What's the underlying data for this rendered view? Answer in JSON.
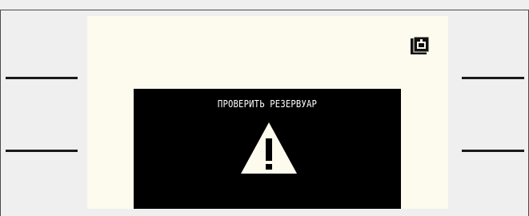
{
  "display": {
    "alert_message": "ПРОВЕРИТЬ РЕЗЕРВУАР",
    "status_icon": "tank-icon",
    "alert_icon": "warning-triangle-icon"
  },
  "colors": {
    "screen_background": "#fdfbee",
    "alert_background": "#000000",
    "alert_text": "#ffffff",
    "frame_line": "#1a1a1a"
  }
}
